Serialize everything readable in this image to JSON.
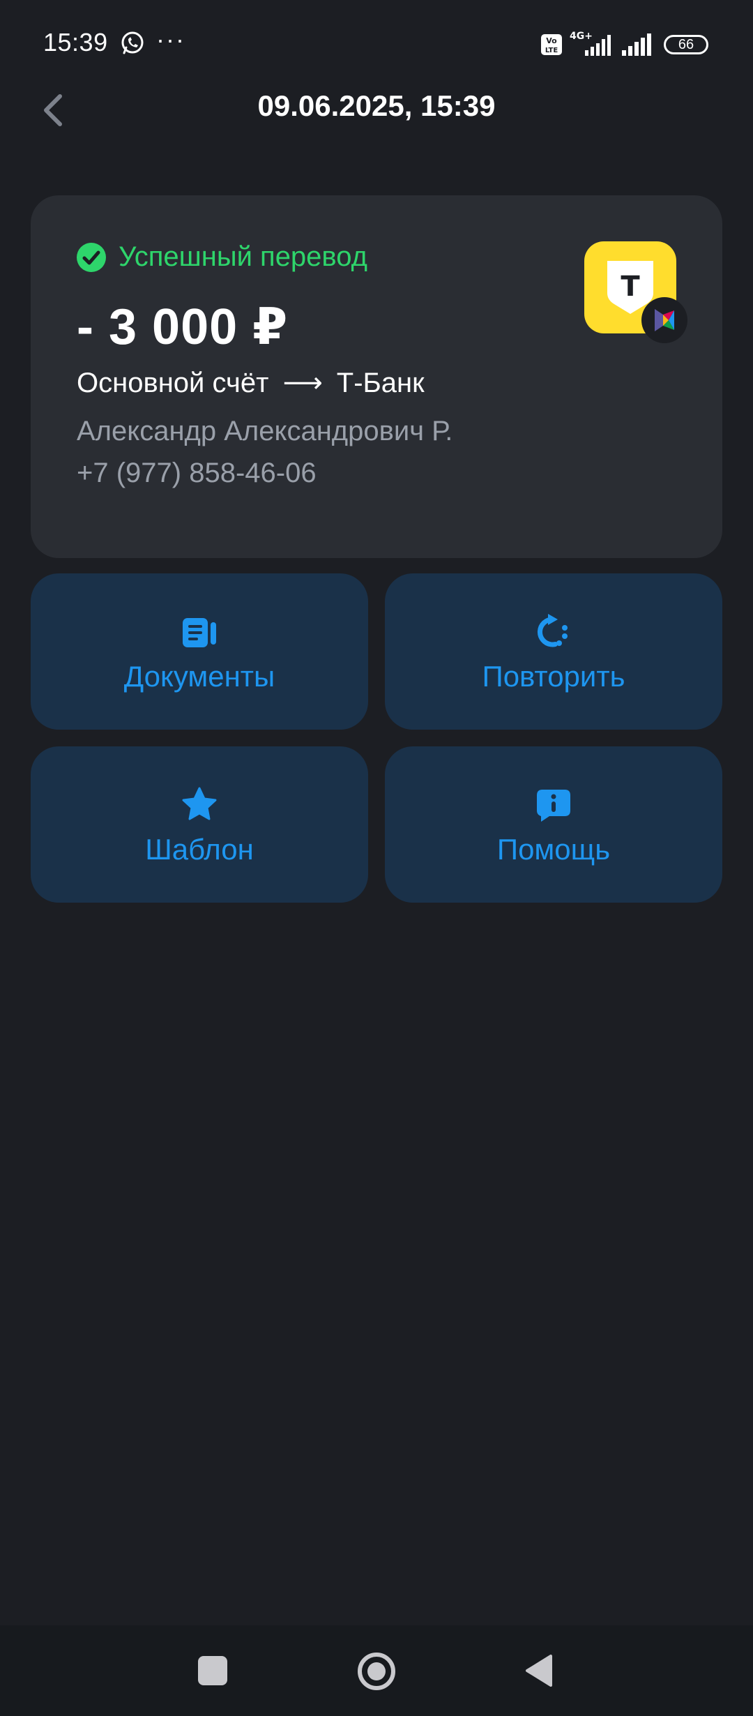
{
  "status_bar": {
    "time": "15:39",
    "dots": "···",
    "network": "4G+",
    "battery": "66"
  },
  "header": {
    "title": "09.06.2025, 15:39"
  },
  "transfer": {
    "status": "Успешный перевод",
    "amount": "- 3 000 ₽",
    "from_account": "Основной счёт",
    "arrow": "⟶",
    "to_bank": "Т-Банк",
    "recipient_name": "Александр Александрович Р.",
    "recipient_phone": "+7 (977) 858-46-06",
    "bank_logo_letter": "Т"
  },
  "actions": {
    "documents": "Документы",
    "repeat": "Повторить",
    "template": "Шаблон",
    "help": "Помощь"
  },
  "colors": {
    "background": "#1c1e23",
    "card": "#2a2d33",
    "action_bg": "#1a3149",
    "accent_blue": "#1e96f0",
    "success_green": "#2ed56b",
    "tbank_yellow": "#ffdd2d"
  }
}
